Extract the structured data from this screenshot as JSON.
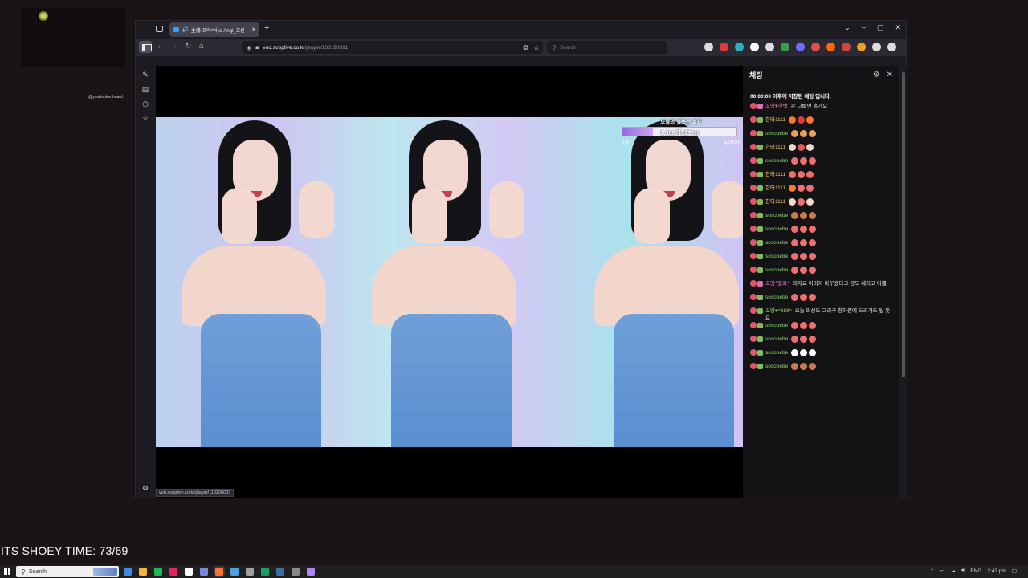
{
  "browser": {
    "tab": {
      "title": "主播 꼬와^어ko Angl_효원",
      "close": "✕"
    },
    "new_tab": "+",
    "url_domain": "vod.sooplive.co.kr",
    "url_path": "/player/138198391",
    "search_placeholder": "Search",
    "window_buttons": {
      "list": "⌄",
      "minimize": "–",
      "maximize": "▢",
      "close": "✕"
    },
    "status_url": "vod.sooplive.co.kr/player/110206003"
  },
  "stream_goal": {
    "title": "오늘의 별풍선 목표",
    "value": "1,366개 (27%)",
    "progress_fraction": 0.27,
    "min": "0개",
    "max": "5,000개"
  },
  "chat": {
    "title": "채팅",
    "notice": "00:00:00 이후에 저장된 채팅 입니다.",
    "messages": [
      {
        "nick": "꼬망♥한백",
        "nick_color": "#f07aa0",
        "badge_color": "#e06cb0",
        "text": "은 나쁘면 혹가요",
        "emotes": []
      },
      {
        "nick": "한타1111",
        "nick_color": "#f6c65a",
        "badge_color": "#7fbf5a",
        "text": "",
        "emotes": [
          "#ff7a2a",
          "#e23b3b",
          "#ff7a2a"
        ]
      },
      {
        "nick": "sosobebe",
        "nick_color": "#8fd36a",
        "badge_color": "#7fbf5a",
        "text": "",
        "emotes": [
          "#e8a05a",
          "#e8a05a",
          "#e8a05a"
        ]
      },
      {
        "nick": "한타1111",
        "nick_color": "#f6c65a",
        "badge_color": "#7fbf5a",
        "text": "",
        "emotes": [
          "#f0d8d0",
          "#e85a5a",
          "#f0d8d0"
        ]
      },
      {
        "nick": "sosobebe",
        "nick_color": "#8fd36a",
        "badge_color": "#7fbf5a",
        "text": "",
        "emotes": [
          "#ef6f6f",
          "#ef6f6f",
          "#ef6f6f"
        ]
      },
      {
        "nick": "한타1111",
        "nick_color": "#f6c65a",
        "badge_color": "#7fbf5a",
        "text": "",
        "emotes": [
          "#ef6f6f",
          "#ef6f6f",
          "#ef6f6f"
        ]
      },
      {
        "nick": "한타1111",
        "nick_color": "#f6c65a",
        "badge_color": "#7fbf5a",
        "text": "",
        "emotes": [
          "#ff7a2a",
          "#ef6f6f",
          "#ef6f6f"
        ]
      },
      {
        "nick": "한타1111",
        "nick_color": "#f6c65a",
        "badge_color": "#7fbf5a",
        "text": "",
        "emotes": [
          "#f0d8d0",
          "#ef6f6f",
          "#f0d8d0"
        ]
      },
      {
        "nick": "sosobebe",
        "nick_color": "#8fd36a",
        "badge_color": "#7fbf5a",
        "text": "",
        "emotes": [
          "#c87a4a",
          "#c87a4a",
          "#c87a4a"
        ]
      },
      {
        "nick": "sosobebe",
        "nick_color": "#8fd36a",
        "badge_color": "#7fbf5a",
        "text": "",
        "emotes": [
          "#ef6f6f",
          "#ef6f6f",
          "#ef6f6f"
        ]
      },
      {
        "nick": "sosobebe",
        "nick_color": "#8fd36a",
        "badge_color": "#7fbf5a",
        "text": "",
        "emotes": [
          "#ef6f6f",
          "#ef6f6f",
          "#ef6f6f"
        ]
      },
      {
        "nick": "sosobebe",
        "nick_color": "#8fd36a",
        "badge_color": "#7fbf5a",
        "text": "",
        "emotes": [
          "#ef6f6f",
          "#ef6f6f",
          "#ef6f6f"
        ]
      },
      {
        "nick": "sosobebe",
        "nick_color": "#8fd36a",
        "badge_color": "#7fbf5a",
        "text": "",
        "emotes": [
          "#ef6f6f",
          "#ef6f6f",
          "#ef6f6f"
        ]
      },
      {
        "nick": "꼬망^별로^",
        "nick_color": "#e57ad8",
        "badge_color": "#e06cb0",
        "text": "미자요 이미지 바꾸겠다고 강도 쎄지고 이쁨",
        "emotes": []
      },
      {
        "nick": "sosobebe",
        "nick_color": "#8fd36a",
        "badge_color": "#7fbf5a",
        "text": "",
        "emotes": [
          "#ef6f6f",
          "#ef6f6f",
          "#ef6f6f"
        ]
      },
      {
        "nick": "꼬망♥^888^",
        "nick_color": "#8fd36a",
        "badge_color": "#7fbf5a",
        "text": "오늘 의상도 그리구 청하중에 드리가도 될 듯요",
        "emotes": []
      },
      {
        "nick": "sosobebe",
        "nick_color": "#8fd36a",
        "badge_color": "#7fbf5a",
        "text": "",
        "emotes": [
          "#ef6f6f",
          "#ef6f6f",
          "#ef6f6f"
        ]
      },
      {
        "nick": "sosobebe",
        "nick_color": "#8fd36a",
        "badge_color": "#7fbf5a",
        "text": "",
        "emotes": [
          "#ef6f6f",
          "#ef6f6f",
          "#ef6f6f"
        ]
      },
      {
        "nick": "sosobebe",
        "nick_color": "#8fd36a",
        "badge_color": "#7fbf5a",
        "text": "",
        "emotes": [
          "#ffffff",
          "#ffffff",
          "#ffffff"
        ]
      },
      {
        "nick": "sosobebe",
        "nick_color": "#8fd36a",
        "badge_color": "#7fbf5a",
        "text": "",
        "emotes": [
          "#c87a4a",
          "#c87a4a",
          "#c87a4a"
        ]
      }
    ]
  },
  "overlay": {
    "handle": "@yourbrokenboard",
    "shoey_text": "ITS SHOEY TIME: 73/69"
  },
  "taskbar": {
    "search_placeholder": "Search",
    "language": "ENG",
    "time": "2:43 pm",
    "apps": [
      "#3a8ee6",
      "#f4b342",
      "#1db954",
      "#e0245e",
      "#ffffff",
      "#7289da",
      "#ff7139",
      "#4aa3df",
      "#9aa0a6",
      "#1c9f5e",
      "#3b6ea8",
      "#888888",
      "#b084f5"
    ],
    "active_app": 6
  },
  "extensions": [
    "#ddd",
    "#e03a3a",
    "#2ab0c8",
    "#ffffff",
    "#dddddd",
    "#3b9e48",
    "#6c6cff",
    "#e54c4c",
    "#ff6a00",
    "#d4443c",
    "#f0a020",
    "#dddddd",
    "#dddddd"
  ],
  "colors": {
    "browser_bg": "#1c1b22",
    "chat_bg": "#131316",
    "accent": "#3aa0ff"
  }
}
